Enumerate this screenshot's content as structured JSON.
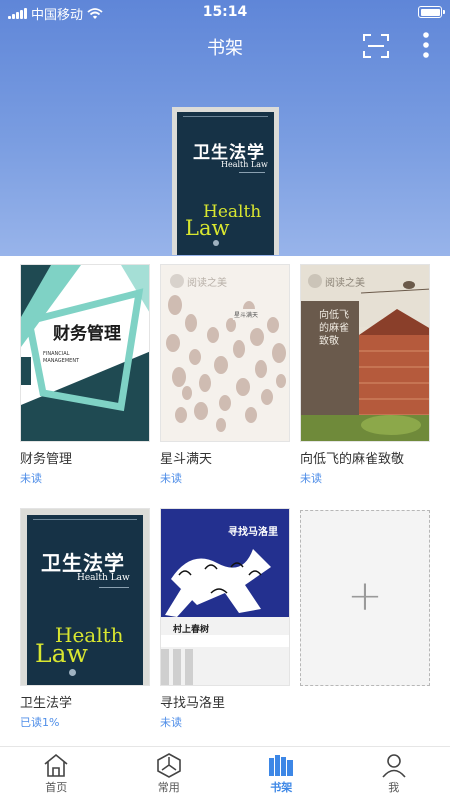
{
  "status_bar": {
    "carrier": "中国移动",
    "time": "15:14"
  },
  "header": {
    "title": "书架"
  },
  "featured": {
    "cover_title": "卫生法学",
    "cover_subtitle": "Health Law",
    "cover_big": [
      "Health",
      "Law"
    ]
  },
  "books": [
    {
      "title": "财务管理",
      "status": "未读",
      "cover_title": "财务管理",
      "cover_sub": "FINANCIAL MANAGEMENT"
    },
    {
      "title": "星斗满天",
      "status": "未读",
      "cover_title": "星斗满天",
      "cover_brand": "阅读之美"
    },
    {
      "title": "向低飞的麻雀致敬",
      "status": "未读",
      "cover_title": "向低飞的麻雀致敬",
      "cover_brand": "阅读之美"
    },
    {
      "title": "卫生法学",
      "status": "已读1%",
      "cover_title": "卫生法学",
      "cover_sub": "Health Law",
      "cover_big": [
        "Health",
        "Law"
      ]
    },
    {
      "title": "寻找马洛里",
      "status": "未读",
      "cover_title": "寻找马洛里",
      "cover_author": "村上春树"
    }
  ],
  "add_button": {
    "symbol": "+"
  },
  "tabs": [
    {
      "label": "首页",
      "icon": "home-icon"
    },
    {
      "label": "常用",
      "icon": "hexagon-icon"
    },
    {
      "label": "书架",
      "icon": "bookshelf-icon",
      "active": true
    },
    {
      "label": "我",
      "icon": "person-icon"
    }
  ],
  "colors": {
    "accent": "#3d87e6",
    "header_top": "#5f86d8",
    "header_bottom": "#98b4ea"
  }
}
